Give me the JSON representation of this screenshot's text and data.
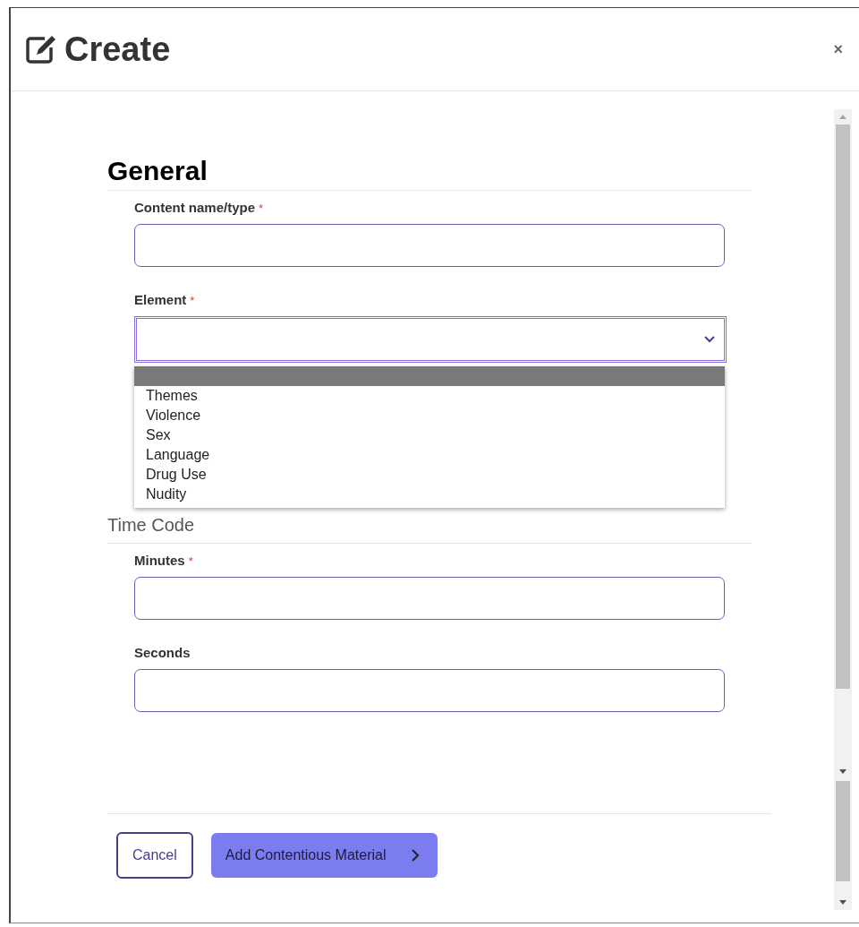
{
  "dialog": {
    "title": "Create",
    "close": "×"
  },
  "sections": [
    {
      "title": "General",
      "kind": "heading",
      "fields": [
        {
          "label": "Content name/type",
          "required": true,
          "kind": "text"
        },
        {
          "label": "Element",
          "required": true,
          "kind": "select",
          "open": true,
          "blank_option_highlighted": true,
          "options": [
            "Themes",
            "Violence",
            "Sex",
            "Language",
            "Drug Use",
            "Nudity"
          ]
        }
      ]
    },
    {
      "title": "Time Code",
      "kind": "subheading",
      "fields": [
        {
          "label": "Minutes",
          "required": true,
          "kind": "text"
        },
        {
          "label": "Seconds",
          "required": false,
          "kind": "text"
        }
      ]
    }
  ],
  "required_mark": "*",
  "buttons": [
    {
      "label": "Cancel",
      "kind": "secondary"
    },
    {
      "label": "Add Contentious Material",
      "kind": "primary"
    }
  ]
}
